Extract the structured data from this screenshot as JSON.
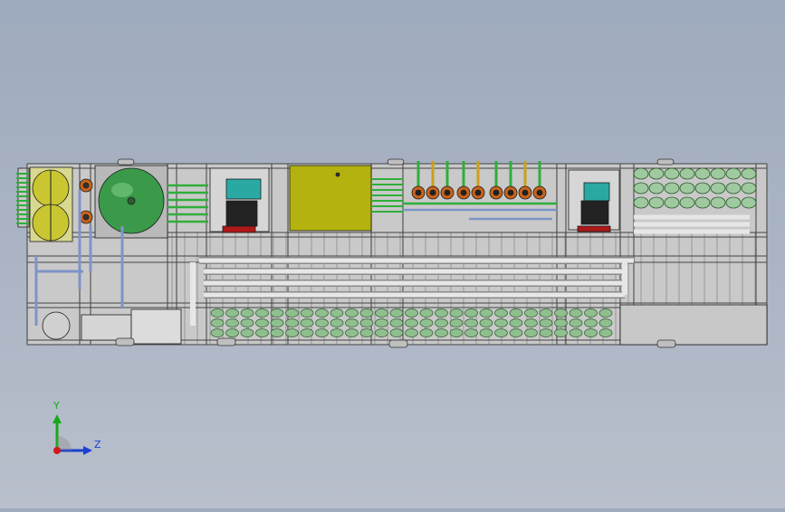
{
  "viewport": {
    "background_top": "#9eaabd",
    "background_bottom": "#b9c0cc"
  },
  "model": {
    "frame_color": "#c9c9c9",
    "line_color": "#1c1c1c",
    "accent_green": "#2fae3a",
    "tank_green": "#3a9a4a",
    "panel_olive": "#b3b20e",
    "pump_teal": "#2aa9a3",
    "motor_red": "#b01818",
    "valve_orange": "#c8641c",
    "pipe_blue": "#7e94c8"
  },
  "triad": {
    "y_label": "Y",
    "z_label": "Z",
    "y_color": "#17a81a",
    "z_color": "#1b3fd0",
    "origin_color": "#d01a1a"
  }
}
